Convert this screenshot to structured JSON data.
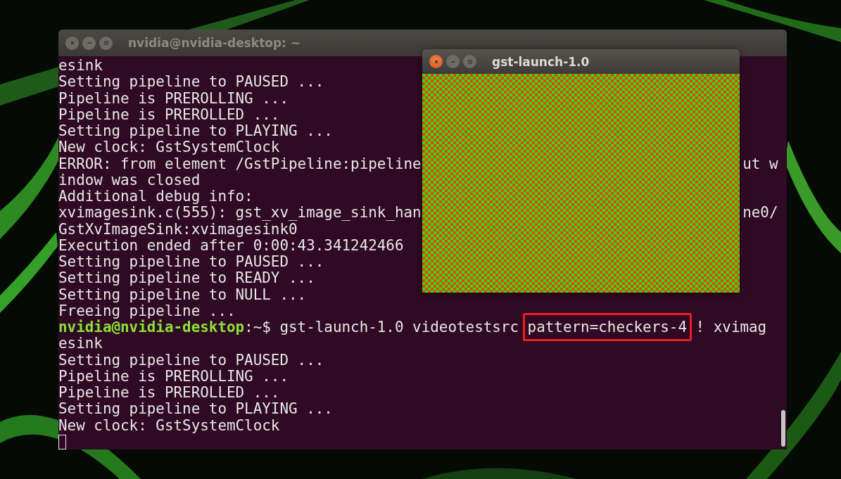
{
  "terminal": {
    "title": "nvidia@nvidia-desktop: ~",
    "active": false,
    "lines": [
      {
        "kind": "text",
        "segments": [
          {
            "kind": "plain",
            "text": "esink"
          }
        ]
      },
      {
        "kind": "text",
        "segments": [
          {
            "kind": "plain",
            "text": "Setting pipeline to PAUSED ..."
          }
        ]
      },
      {
        "kind": "text",
        "segments": [
          {
            "kind": "plain",
            "text": "Pipeline is PREROLLING ..."
          }
        ]
      },
      {
        "kind": "text",
        "segments": [
          {
            "kind": "plain",
            "text": "Pipeline is PREROLLED ..."
          }
        ]
      },
      {
        "kind": "text",
        "segments": [
          {
            "kind": "plain",
            "text": "Setting pipeline to PLAYING ..."
          }
        ]
      },
      {
        "kind": "text",
        "segments": [
          {
            "kind": "plain",
            "text": "New clock: GstSystemClock"
          }
        ]
      },
      {
        "kind": "text",
        "segments": [
          {
            "kind": "plain",
            "text": "ERROR: from element /GstPipeline:pipeline"
          }
        ],
        "right": "ut w"
      },
      {
        "kind": "text",
        "segments": [
          {
            "kind": "plain",
            "text": "indow was closed"
          }
        ]
      },
      {
        "kind": "text",
        "segments": [
          {
            "kind": "plain",
            "text": "Additional debug info:"
          }
        ]
      },
      {
        "kind": "text",
        "segments": [
          {
            "kind": "plain",
            "text": "xvimagesink.c(555): gst_xv_image_sink_han"
          }
        ],
        "right": "ne0/"
      },
      {
        "kind": "text",
        "segments": [
          {
            "kind": "plain",
            "text": "GstXvImageSink:xvimagesink0"
          }
        ]
      },
      {
        "kind": "text",
        "segments": [
          {
            "kind": "plain",
            "text": "Execution ended after 0:00:43.341242466"
          }
        ]
      },
      {
        "kind": "text",
        "segments": [
          {
            "kind": "plain",
            "text": "Setting pipeline to PAUSED ..."
          }
        ]
      },
      {
        "kind": "text",
        "segments": [
          {
            "kind": "plain",
            "text": "Setting pipeline to READY ..."
          }
        ]
      },
      {
        "kind": "text",
        "segments": [
          {
            "kind": "plain",
            "text": "Setting pipeline to NULL ..."
          }
        ]
      },
      {
        "kind": "text",
        "segments": [
          {
            "kind": "plain",
            "text": "Freeing pipeline ..."
          }
        ]
      },
      {
        "kind": "text",
        "segments": [
          {
            "kind": "prompt",
            "text": "nvidia@nvidia-desktop"
          },
          {
            "kind": "plain",
            "text": ":~$ gst-launch-1.0 videotestsrc "
          },
          {
            "kind": "highlight",
            "text": "pattern=checkers-4"
          },
          {
            "kind": "plain",
            "text": " ! xvimag"
          }
        ]
      },
      {
        "kind": "text",
        "segments": [
          {
            "kind": "plain",
            "text": "esink"
          }
        ]
      },
      {
        "kind": "text",
        "segments": [
          {
            "kind": "plain",
            "text": "Setting pipeline to PAUSED ..."
          }
        ]
      },
      {
        "kind": "text",
        "segments": [
          {
            "kind": "plain",
            "text": "Pipeline is PREROLLING ..."
          }
        ]
      },
      {
        "kind": "text",
        "segments": [
          {
            "kind": "plain",
            "text": "Pipeline is PREROLLED ..."
          }
        ]
      },
      {
        "kind": "text",
        "segments": [
          {
            "kind": "plain",
            "text": "Setting pipeline to PLAYING ..."
          }
        ]
      },
      {
        "kind": "text",
        "segments": [
          {
            "kind": "plain",
            "text": "New clock: GstSystemClock"
          }
        ]
      },
      {
        "kind": "cursor"
      }
    ]
  },
  "video_window": {
    "title": "gst-launch-1.0",
    "active": true
  }
}
